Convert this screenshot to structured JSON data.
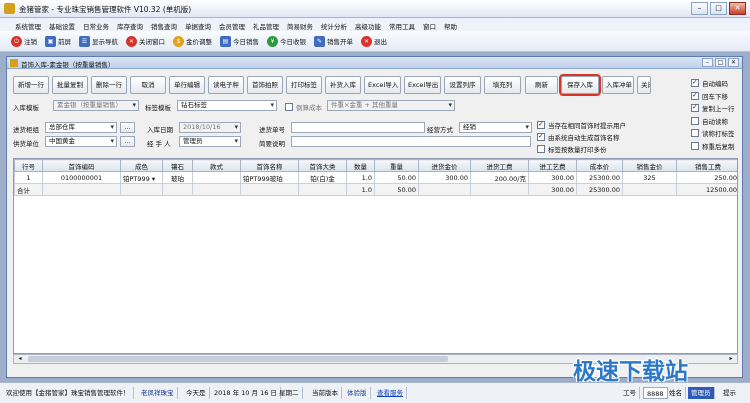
{
  "window": {
    "title": "金猪管家 - 专业珠宝销售管理软件 V10.32 (单机版)"
  },
  "menu": [
    "系统管理",
    "基础设置",
    "日常业务",
    "库存查询",
    "销售查询",
    "单据查询",
    "会员管理",
    "礼品管理",
    "简易财务",
    "统计分析",
    "高级功能",
    "常用工具",
    "窗口",
    "帮助"
  ],
  "toolbar": [
    {
      "label": "注销",
      "icon": "power-icon",
      "color": "#d6332a"
    },
    {
      "label": "前屏",
      "icon": "front-screen-icon",
      "color": "#3f6cc2"
    },
    {
      "label": "显示导航",
      "icon": "navigation-icon",
      "color": "#3f6cc2"
    },
    {
      "label": "关闭窗口",
      "icon": "close-window-icon",
      "color": "#d6332a"
    },
    {
      "label": "金价调整",
      "icon": "gold-price-icon",
      "color": "#e0a11b"
    },
    {
      "label": "今日销售",
      "icon": "today-sales-icon",
      "color": "#3f6cc2"
    },
    {
      "label": "今日收银",
      "icon": "today-cashier-icon",
      "color": "#2c9a3c"
    },
    {
      "label": "销售开单",
      "icon": "sales-order-icon",
      "color": "#3f6cc2"
    },
    {
      "label": "退出",
      "icon": "exit-icon",
      "color": "#d6332a"
    }
  ],
  "child_window": {
    "title": "首饰入库-素金银（按重量销售）"
  },
  "buttons": [
    "新增一行",
    "批量复制",
    "删除一行",
    "取消",
    "单行编辑",
    "读电子秤",
    "首饰拍照",
    "打印标签",
    "补货入库",
    "Excel导入",
    "Excel导出",
    "设置列序",
    "填充列",
    "刷新",
    "保存入库",
    "入库冲单",
    "关闭"
  ],
  "checkboxes": [
    {
      "label": "自动编码",
      "checked": true
    },
    {
      "label": "回车下移",
      "checked": true
    },
    {
      "label": "复制上一行",
      "checked": true
    },
    {
      "label": "自动读称",
      "checked": false
    },
    {
      "label": "读称打标签",
      "checked": false
    },
    {
      "label": "称重后复制",
      "checked": false
    }
  ],
  "form": {
    "template_label": "入库模板",
    "template_value": "素金银（按重量销售）",
    "tag_template_label": "标签模板",
    "tag_template_value": "钻石标签",
    "cost_check_label": "倒算成本",
    "cost_formula": "件重×金重 + 其他重量",
    "warehouse_label": "进货柜组",
    "warehouse_value": "总部仓库",
    "date_label": "入库日期",
    "date_value": "2018/10/16",
    "order_no_label": "进货单号",
    "order_no_value": "",
    "method_label": "经营方式",
    "method_value": "经销",
    "supplier_label": "供货单位",
    "supplier_value": "中国黄金",
    "handler_label": "经 手 人",
    "handler_value": "管理员",
    "remark_label": "简要说明",
    "remark_value": "",
    "opt1": {
      "label": "当存在相同首饰时提示用户",
      "checked": true
    },
    "opt2": {
      "label": "由系统自动生成首饰名称",
      "checked": true
    },
    "opt3": {
      "label": "标签按数量打印多份",
      "checked": false
    }
  },
  "grid": {
    "headers": [
      "行号",
      "首饰编码",
      "成色",
      "镶石",
      "款式",
      "首饰名称",
      "首饰大类",
      "数量",
      "重量",
      "进货金价",
      "进货工费",
      "进工艺费",
      "成本价",
      "销售金价",
      "销售工费"
    ],
    "rows": [
      [
        "1",
        "0100000001",
        "铂PT999",
        "玻珀",
        "",
        "铂PT999玻珀",
        "铂(白)金",
        "1.0",
        "50.00",
        "300.00",
        "200.00/克",
        "300.00",
        "25300.00",
        "325",
        "250.00"
      ]
    ],
    "total": [
      "合计",
      "",
      "",
      "",
      "",
      "",
      "",
      "1.0",
      "50.00",
      "",
      "",
      "300.00",
      "25300.00",
      "",
      "12500.00"
    ]
  },
  "status": {
    "welcome": "欢迎使用【金猪管家】珠宝销售管理软件！",
    "user": "老凤祥珠宝",
    "today_label": "今天是",
    "date": "2018 年 10 月 16 日",
    "weekday": "星期二",
    "version_label": "当前版本",
    "version": "体验版",
    "service": "查看服务",
    "job_no_label": "工号",
    "job_no": "8888",
    "name_label": "姓名",
    "name": "管理员",
    "tip": "提示"
  },
  "watermark": "极速下载站"
}
